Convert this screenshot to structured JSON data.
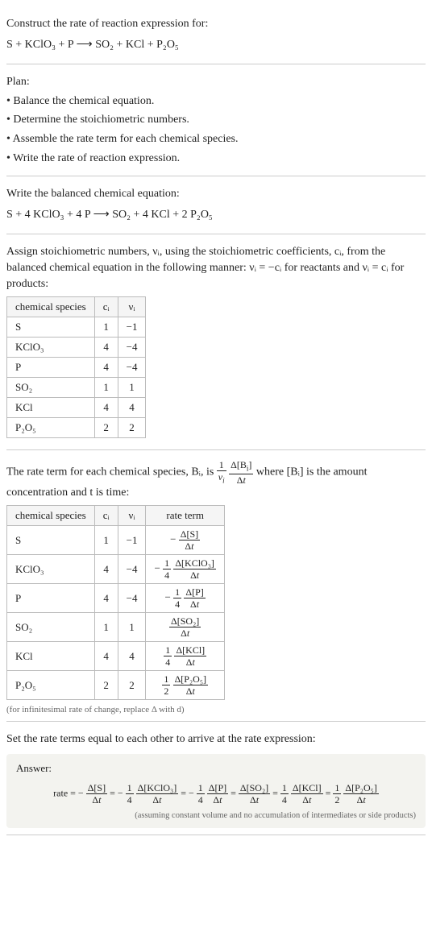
{
  "intro": {
    "line1": "Construct the rate of reaction expression for:",
    "eq": "S + KClO₃ + P ⟶ SO₂ + KCl + P₂O₅"
  },
  "plan": {
    "heading": "Plan:",
    "items": [
      "• Balance the chemical equation.",
      "• Determine the stoichiometric numbers.",
      "• Assemble the rate term for each chemical species.",
      "• Write the rate of reaction expression."
    ]
  },
  "balanced": {
    "line1": "Write the balanced chemical equation:",
    "eq": "S + 4 KClO₃ + 4 P ⟶ SO₂ + 4 KCl + 2 P₂O₅"
  },
  "stoich_intro": "Assign stoichiometric numbers, νᵢ, using the stoichiometric coefficients, cᵢ, from the balanced chemical equation in the following manner: νᵢ = −cᵢ for reactants and νᵢ = cᵢ for products:",
  "stoich_table": {
    "headers": [
      "chemical species",
      "cᵢ",
      "νᵢ"
    ],
    "rows": [
      [
        "S",
        "1",
        "−1"
      ],
      [
        "KClO₃",
        "4",
        "−4"
      ],
      [
        "P",
        "4",
        "−4"
      ],
      [
        "SO₂",
        "1",
        "1"
      ],
      [
        "KCl",
        "4",
        "4"
      ],
      [
        "P₂O₅",
        "2",
        "2"
      ]
    ]
  },
  "rate_term_intro_a": "The rate term for each chemical species, Bᵢ, is ",
  "rate_term_intro_b": " where [Bᵢ] is the amount concentration and t is time:",
  "rate_table": {
    "headers": [
      "chemical species",
      "cᵢ",
      "νᵢ",
      "rate term"
    ],
    "rows": [
      {
        "sp": "S",
        "c": "1",
        "v": "−1",
        "coef_num": "",
        "coef_den": "",
        "neg": true,
        "d": "Δ[S]"
      },
      {
        "sp": "KClO₃",
        "c": "4",
        "v": "−4",
        "coef_num": "1",
        "coef_den": "4",
        "neg": true,
        "d": "Δ[KClO₃]"
      },
      {
        "sp": "P",
        "c": "4",
        "v": "−4",
        "coef_num": "1",
        "coef_den": "4",
        "neg": true,
        "d": "Δ[P]"
      },
      {
        "sp": "SO₂",
        "c": "1",
        "v": "1",
        "coef_num": "",
        "coef_den": "",
        "neg": false,
        "d": "Δ[SO₂]"
      },
      {
        "sp": "KCl",
        "c": "4",
        "v": "4",
        "coef_num": "1",
        "coef_den": "4",
        "neg": false,
        "d": "Δ[KCl]"
      },
      {
        "sp": "P₂O₅",
        "c": "2",
        "v": "2",
        "coef_num": "1",
        "coef_den": "2",
        "neg": false,
        "d": "Δ[P₂O₅]"
      }
    ]
  },
  "infinitesimal_note": "(for infinitesimal rate of change, replace Δ with d)",
  "final_intro": "Set the rate terms equal to each other to arrive at the rate expression:",
  "answer": {
    "label": "Answer:",
    "prefix": "rate = ",
    "terms": [
      {
        "neg": true,
        "coef_num": "",
        "coef_den": "",
        "d": "Δ[S]"
      },
      {
        "neg": true,
        "coef_num": "1",
        "coef_den": "4",
        "d": "Δ[KClO₃]"
      },
      {
        "neg": true,
        "coef_num": "1",
        "coef_den": "4",
        "d": "Δ[P]"
      },
      {
        "neg": false,
        "coef_num": "",
        "coef_den": "",
        "d": "Δ[SO₂]"
      },
      {
        "neg": false,
        "coef_num": "1",
        "coef_den": "4",
        "d": "Δ[KCl]"
      },
      {
        "neg": false,
        "coef_num": "1",
        "coef_den": "2",
        "d": "Δ[P₂O₅]"
      }
    ],
    "note": "(assuming constant volume and no accumulation of intermediates or side products)"
  },
  "chart_data": {
    "type": "table",
    "tables": [
      {
        "title": "Stoichiometric numbers",
        "headers": [
          "chemical species",
          "c_i",
          "nu_i"
        ],
        "rows": [
          [
            "S",
            1,
            -1
          ],
          [
            "KClO3",
            4,
            -4
          ],
          [
            "P",
            4,
            -4
          ],
          [
            "SO2",
            1,
            1
          ],
          [
            "KCl",
            4,
            4
          ],
          [
            "P2O5",
            2,
            2
          ]
        ]
      },
      {
        "title": "Rate terms",
        "headers": [
          "chemical species",
          "c_i",
          "nu_i",
          "rate term"
        ],
        "rows": [
          [
            "S",
            1,
            -1,
            "-(Δ[S]/Δt)"
          ],
          [
            "KClO3",
            4,
            -4,
            "-(1/4)(Δ[KClO3]/Δt)"
          ],
          [
            "P",
            4,
            -4,
            "-(1/4)(Δ[P]/Δt)"
          ],
          [
            "SO2",
            1,
            1,
            "(Δ[SO2]/Δt)"
          ],
          [
            "KCl",
            4,
            4,
            "(1/4)(Δ[KCl]/Δt)"
          ],
          [
            "P2O5",
            2,
            2,
            "(1/2)(Δ[P2O5]/Δt)"
          ]
        ]
      }
    ]
  }
}
